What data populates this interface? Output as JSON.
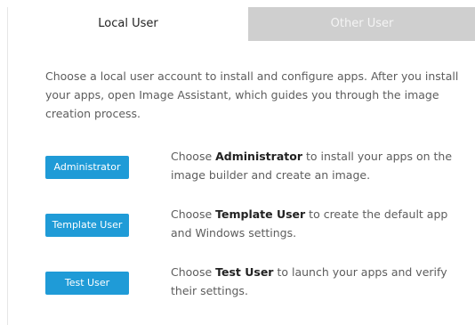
{
  "tabs": {
    "local": "Local User",
    "other": "Other User"
  },
  "intro": "Choose a local user account to install and configure apps. After you install your apps, open Image Assistant, which guides you through the image creation process.",
  "options": [
    {
      "button": "Administrator",
      "desc_pre": "Choose ",
      "desc_bold": "Administrator",
      "desc_post": " to install your apps on the image builder and create an image."
    },
    {
      "button": "Template User",
      "desc_pre": "Choose ",
      "desc_bold": "Template User",
      "desc_post": " to create the default app and Windows settings."
    },
    {
      "button": "Test User",
      "desc_pre": "Choose ",
      "desc_bold": "Test User",
      "desc_post": " to launch your apps and verify their settings."
    }
  ],
  "colors": {
    "button": "#1f9bd7",
    "inactive_tab": "#cfcfcf"
  }
}
